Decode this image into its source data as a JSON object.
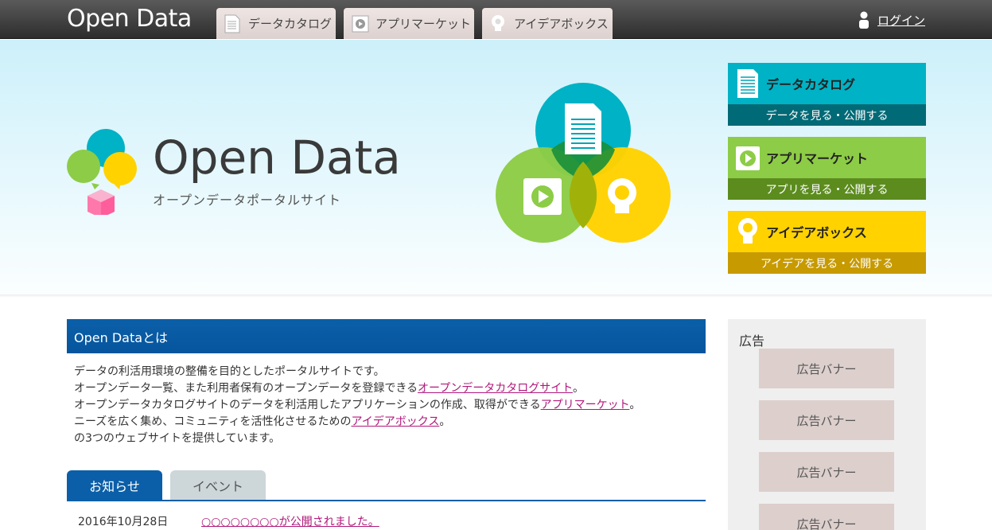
{
  "header": {
    "logo": "Open Data",
    "nav": [
      {
        "label": "データカタログ",
        "icon": "document-icon"
      },
      {
        "label": "アプリマーケット",
        "icon": "play-icon"
      },
      {
        "label": "アイデアボックス",
        "icon": "bulb-icon"
      }
    ],
    "login_label": "ログイン"
  },
  "hero": {
    "title": "Open Data",
    "subtitle": "オープンデータポータルサイト",
    "cards": [
      {
        "title": "データカタログ",
        "action": "データを見る・公開する",
        "top_color": "#00b2c5",
        "bottom_color": "#006a76",
        "icon": "document-icon"
      },
      {
        "title": "アプリマーケット",
        "action": "アプリを見る・公開する",
        "top_color": "#8dcc46",
        "bottom_color": "#5c8c1e",
        "icon": "play-icon"
      },
      {
        "title": "アイデアボックス",
        "action": "アイデアを見る・公開する",
        "top_color": "#ffd200",
        "bottom_color": "#c79a00",
        "icon": "bulb-icon"
      }
    ]
  },
  "about": {
    "heading": "Open Dataとは",
    "lines": [
      {
        "text": "データの利活用環境の整備を目的としたポータルサイトです。",
        "link": "",
        "tail": ""
      },
      {
        "text": "オープンデータ一覧、また利用者保有のオープンデータを登録できる",
        "link": "オープンデータカタログサイト",
        "tail": "。"
      },
      {
        "text": "オープンデータカタログサイトのデータを利活用したアプリケーションの作成、取得ができる",
        "link": "アプリマーケット",
        "tail": "。"
      },
      {
        "text": "ニーズを広く集め、コミュニティを活性化させるための",
        "link": "アイデアボックス",
        "tail": "。"
      },
      {
        "text": "の3つのウェブサイトを提供しています。",
        "link": "",
        "tail": ""
      }
    ]
  },
  "tabs": {
    "news": "お知らせ",
    "event": "イベント"
  },
  "news": [
    {
      "date": "2016年10月28日",
      "title": "○○○○○○○○が公開されました。"
    }
  ],
  "ads": {
    "title": "広告",
    "banners": [
      "広告バナー",
      "広告バナー",
      "広告バナー",
      "広告バナー"
    ]
  },
  "colors": {
    "brand_blue": "#0b5fa8",
    "link_magenta": "#b0187a"
  }
}
